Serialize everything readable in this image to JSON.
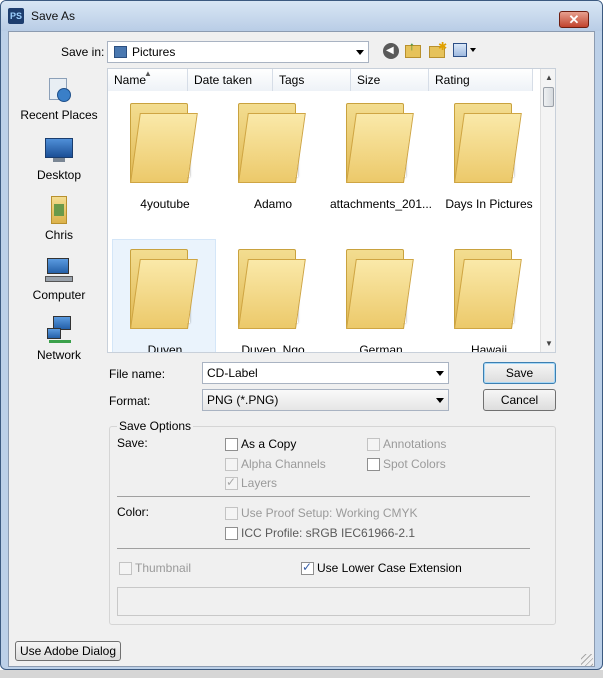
{
  "window": {
    "title": "Save As",
    "app_icon": "PS"
  },
  "nav": {
    "save_in_label": "Save in:",
    "location": "Pictures"
  },
  "places": [
    {
      "label": "Recent Places",
      "icon": "recent-places-icon"
    },
    {
      "label": "Desktop",
      "icon": "desktop-icon"
    },
    {
      "label": "Chris",
      "icon": "user-folder-icon"
    },
    {
      "label": "Computer",
      "icon": "computer-icon"
    },
    {
      "label": "Network",
      "icon": "network-icon"
    }
  ],
  "columns": [
    "Name",
    "Date taken",
    "Tags",
    "Size",
    "Rating"
  ],
  "folders": [
    {
      "name": "4youtube",
      "color": "#2a2e4a"
    },
    {
      "name": "Adamo",
      "color": "#7a2430"
    },
    {
      "name": "attachments_201...",
      "color": "#4d7a5a"
    },
    {
      "name": "Days In Pictures",
      "color": "#3a3f4c"
    },
    {
      "name": "Duyen",
      "color": "#b0707a"
    },
    {
      "name": "Duyen_Ngo",
      "color": "#6a5848"
    },
    {
      "name": "German",
      "color": "#8a8a8a"
    },
    {
      "name": "Hawaii",
      "color": "#cfd9e0"
    }
  ],
  "file": {
    "file_name_label": "File name:",
    "file_name_value": "CD-Label",
    "format_label": "Format:",
    "format_value": "PNG (*.PNG)",
    "save_button": "Save",
    "cancel_button": "Cancel"
  },
  "options": {
    "group_label": "Save Options",
    "save_label": "Save:",
    "as_copy": "As a Copy",
    "annotations": "Annotations",
    "alpha_channels": "Alpha Channels",
    "spot_colors": "Spot Colors",
    "layers": "Layers",
    "color_label": "Color:",
    "use_proof_setup": "Use Proof Setup:  Working CMYK",
    "icc_profile": "ICC Profile:  sRGB IEC61966-2.1",
    "thumbnail": "Thumbnail",
    "lower_case_extension": "Use Lower Case Extension"
  },
  "footer": {
    "use_adobe_dialog": "Use Adobe Dialog"
  }
}
